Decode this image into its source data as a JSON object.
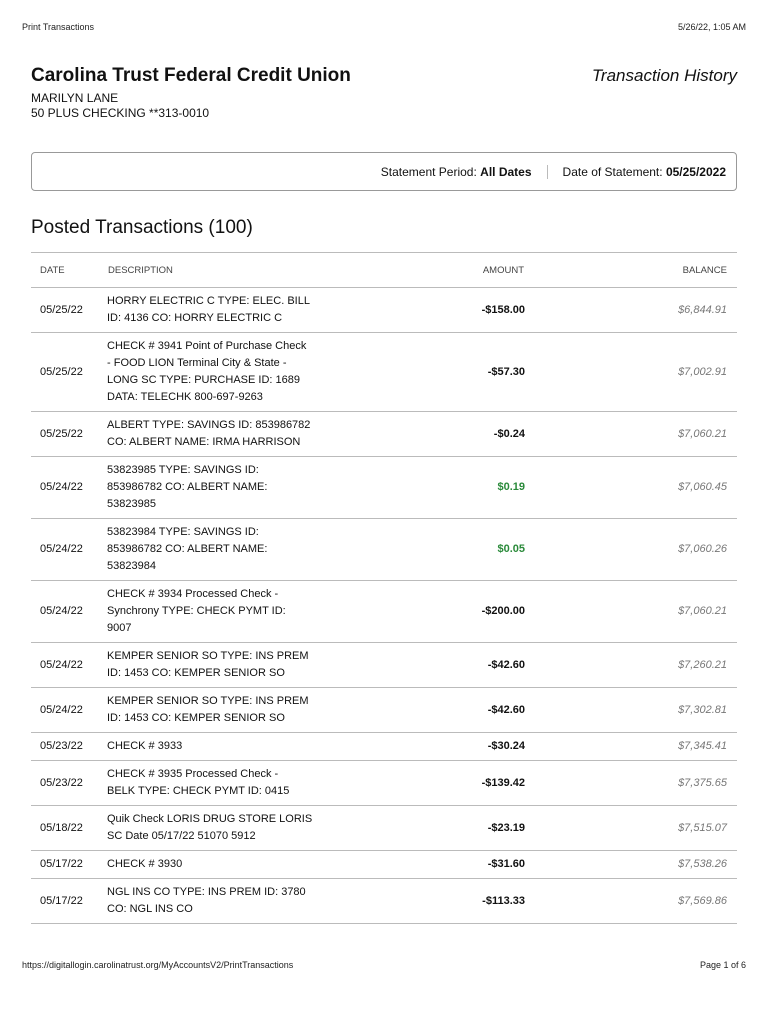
{
  "print_header": {
    "title": "Print Transactions",
    "datetime": "5/26/22, 1:05 AM"
  },
  "header": {
    "bank_name": "Carolina Trust Federal Credit Union",
    "doc_title": "Transaction History",
    "member_name": "MARILYN LANE",
    "account": "50 PLUS CHECKING **313-0010"
  },
  "statement": {
    "period_label": "Statement Period:",
    "period_value": "All Dates",
    "date_label": "Date of Statement:",
    "date_value": "05/25/2022"
  },
  "section_title": "Posted Transactions (100)",
  "columns": {
    "date": "DATE",
    "description": "DESCRIPTION",
    "amount": "AMOUNT",
    "balance": "BALANCE"
  },
  "colors": {
    "credit": "#2a8a3a",
    "balance": "#777777"
  },
  "transactions": [
    {
      "date": "05/25/22",
      "description": "HORRY ELECTRIC C TYPE: ELEC. BILL\nID: 4136 CO: HORRY ELECTRIC C",
      "amount": "-$158.00",
      "balance": "$6,844.91"
    },
    {
      "date": "05/25/22",
      "description": "CHECK # 3941 Point of Purchase Check\n- FOOD LION Terminal City & State -\nLONG SC TYPE: PURCHASE ID: 1689\nDATA: TELECHK 800-697-9263",
      "amount": "-$57.30",
      "balance": "$7,002.91"
    },
    {
      "date": "05/25/22",
      "description": "ALBERT TYPE: SAVINGS ID: 853986782\nCO: ALBERT NAME: IRMA HARRISON",
      "amount": "-$0.24",
      "balance": "$7,060.21"
    },
    {
      "date": "05/24/22",
      "description": "53823985 TYPE: SAVINGS ID:\n853986782 CO: ALBERT NAME:\n53823985",
      "amount": "$0.19",
      "balance": "$7,060.45",
      "credit": true
    },
    {
      "date": "05/24/22",
      "description": "53823984 TYPE: SAVINGS ID:\n853986782 CO: ALBERT NAME:\n53823984",
      "amount": "$0.05",
      "balance": "$7,060.26",
      "credit": true
    },
    {
      "date": "05/24/22",
      "description": "CHECK # 3934 Processed Check -\nSynchrony TYPE: CHECK PYMT ID:\n9007",
      "amount": "-$200.00",
      "balance": "$7,060.21"
    },
    {
      "date": "05/24/22",
      "description": "KEMPER SENIOR SO TYPE: INS PREM\nID: 1453 CO: KEMPER SENIOR SO",
      "amount": "-$42.60",
      "balance": "$7,260.21"
    },
    {
      "date": "05/24/22",
      "description": "KEMPER SENIOR SO TYPE: INS PREM\nID: 1453 CO: KEMPER SENIOR SO",
      "amount": "-$42.60",
      "balance": "$7,302.81"
    },
    {
      "date": "05/23/22",
      "description": "CHECK # 3933",
      "amount": "-$30.24",
      "balance": "$7,345.41"
    },
    {
      "date": "05/23/22",
      "description": "CHECK # 3935 Processed Check -\nBELK TYPE: CHECK PYMT ID: 0415",
      "amount": "-$139.42",
      "balance": "$7,375.65"
    },
    {
      "date": "05/18/22",
      "description": "Quik Check LORIS DRUG STORE LORIS\nSC Date 05/17/22 51070 5912",
      "amount": "-$23.19",
      "balance": "$7,515.07"
    },
    {
      "date": "05/17/22",
      "description": "CHECK # 3930",
      "amount": "-$31.60",
      "balance": "$7,538.26"
    },
    {
      "date": "05/17/22",
      "description": "NGL INS CO TYPE: INS PREM ID: 3780\nCO: NGL INS CO",
      "amount": "-$113.33",
      "balance": "$7,569.86"
    }
  ],
  "footer": {
    "url": "https://digitallogin.carolinatrust.org/MyAccountsV2/PrintTransactions",
    "page": "Page 1 of 6"
  }
}
